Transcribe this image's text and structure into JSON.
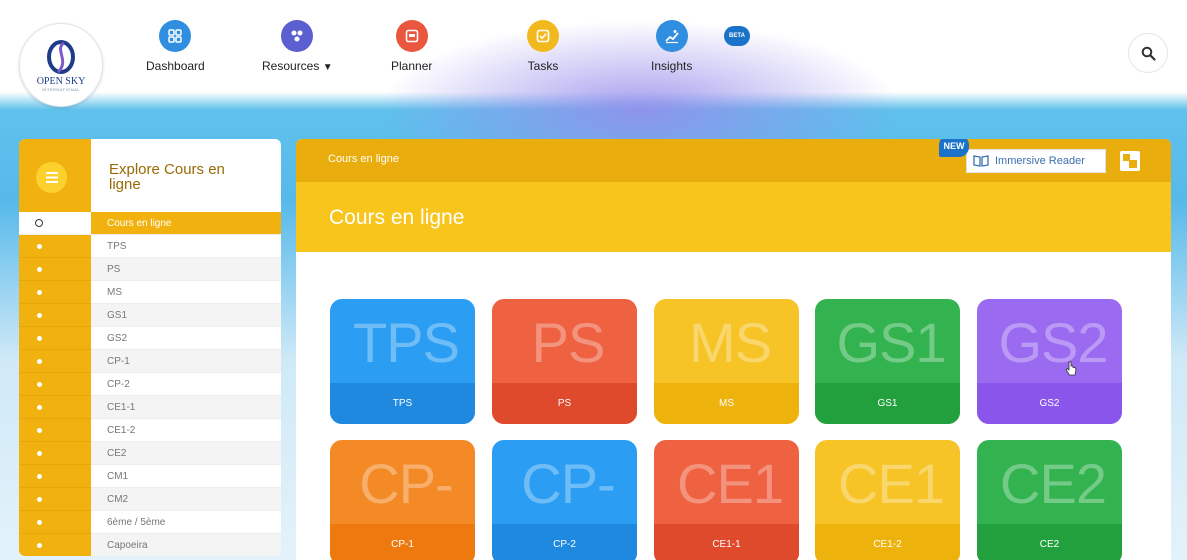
{
  "nav": {
    "logo": {
      "name": "OPEN SKY",
      "sub": "INTERNATIONAL"
    },
    "items": [
      {
        "label": "Dashboard",
        "icon": "dashboard-grid-icon",
        "color": "#2f8ee0"
      },
      {
        "label": "Resources",
        "icon": "resources-cluster-icon",
        "color": "#5b5fd0",
        "dropdown": true
      },
      {
        "label": "Planner",
        "icon": "planner-icon",
        "color": "#e9573f"
      },
      {
        "label": "Tasks",
        "icon": "tasks-check-icon",
        "color": "#f2b91e"
      },
      {
        "label": "Insights",
        "icon": "insights-chart-icon",
        "color": "#2f8ee0"
      }
    ],
    "beta_label": "BETA",
    "search_icon": "search-icon"
  },
  "sidebar": {
    "title": "Explore Cours en ligne",
    "items": [
      {
        "label": "Cours en ligne",
        "active": true
      },
      {
        "label": "TPS"
      },
      {
        "label": "PS"
      },
      {
        "label": "MS"
      },
      {
        "label": "GS1"
      },
      {
        "label": "GS2"
      },
      {
        "label": "CP-1"
      },
      {
        "label": "CP-2"
      },
      {
        "label": "CE1-1"
      },
      {
        "label": "CE1-2"
      },
      {
        "label": "CE2"
      },
      {
        "label": "CM1"
      },
      {
        "label": "CM2"
      },
      {
        "label": "6ème / 5ème"
      },
      {
        "label": "Capoeira"
      }
    ]
  },
  "main": {
    "breadcrumb": "Cours en ligne",
    "title": "Cours en ligne",
    "new_badge": "NEW",
    "immersive_reader": "Immersive Reader",
    "tiles": [
      {
        "big": "TPS",
        "label": "TPS",
        "color": "#2b9ef3",
        "foot": "#1f88df"
      },
      {
        "big": "PS",
        "label": "PS",
        "color": "#ee6141",
        "foot": "#de4a2b"
      },
      {
        "big": "MS",
        "label": "MS",
        "color": "#f6c427",
        "foot": "#eeb20d"
      },
      {
        "big": "GS1",
        "label": "GS1",
        "color": "#33b34f",
        "foot": "#23a03e"
      },
      {
        "big": "GS2",
        "label": "GS2",
        "color": "#9a6af0",
        "foot": "#8a55ea"
      },
      {
        "big": "CP-",
        "label": "CP-1",
        "color": "#f48a25",
        "foot": "#ee7a0f"
      },
      {
        "big": "CP-",
        "label": "CP-2",
        "color": "#2b9ef3",
        "foot": "#1f88df"
      },
      {
        "big": "CE1",
        "label": "CE1-1",
        "color": "#ee6141",
        "foot": "#de4a2b"
      },
      {
        "big": "CE1",
        "label": "CE1-2",
        "color": "#f6c427",
        "foot": "#eeb20d"
      },
      {
        "big": "CE2",
        "label": "CE2",
        "color": "#33b34f",
        "foot": "#23a03e"
      }
    ]
  }
}
